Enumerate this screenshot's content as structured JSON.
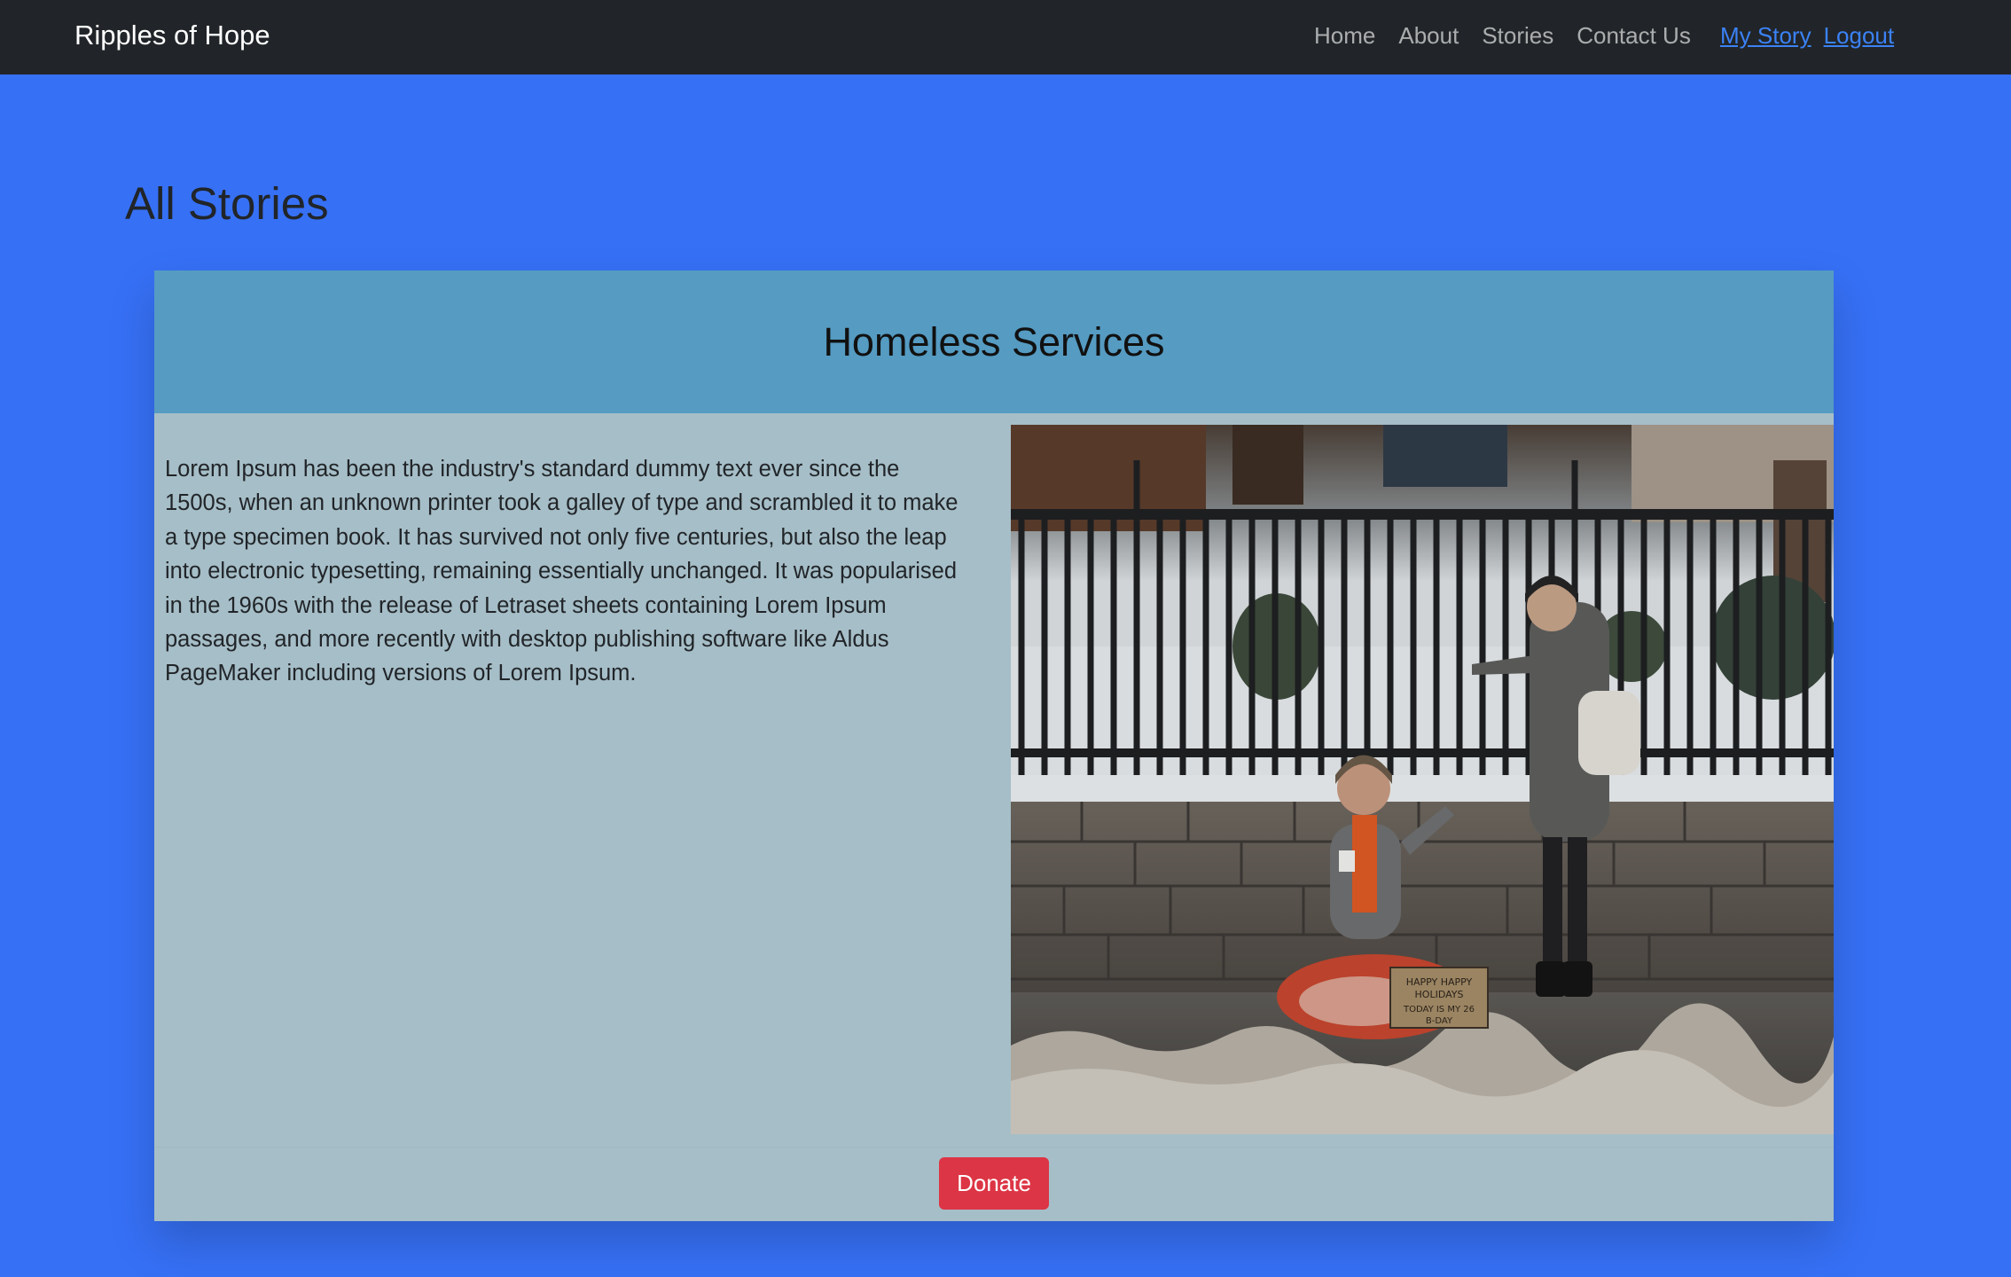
{
  "nav": {
    "brand": "Ripples of Hope",
    "links": [
      {
        "label": "Home"
      },
      {
        "label": "About"
      },
      {
        "label": "Stories"
      },
      {
        "label": "Contact Us"
      }
    ],
    "user_links": [
      {
        "label": "My Story"
      },
      {
        "label": "Logout"
      }
    ]
  },
  "page": {
    "title": "All Stories"
  },
  "story": {
    "title": "Homeless Services",
    "text": "Lorem Ipsum has been the industry's standard dummy text ever since the 1500s, when an unknown printer took a galley of type and scrambled it to make a type specimen book. It has survived not only five centuries, but also the leap into electronic typesetting, remaining essentially unchanged. It was popularised in the 1960s with the release of Letraset sheets containing Lorem Ipsum passages, and more recently with desktop publishing software like Aldus PageMaker including versions of Lorem Ipsum.",
    "image_sign_text": "HAPPY HAPPY HOLIDAYS TODAY IS MY 26 B-DAY",
    "donate_label": "Donate"
  },
  "colors": {
    "navbar_bg": "#212529",
    "page_bg": "#3670f5",
    "card_header_bg": "#559bc2",
    "card_body_bg": "#a6bec7",
    "donate_bg": "#dc3545",
    "link_color": "#3b82f6"
  }
}
